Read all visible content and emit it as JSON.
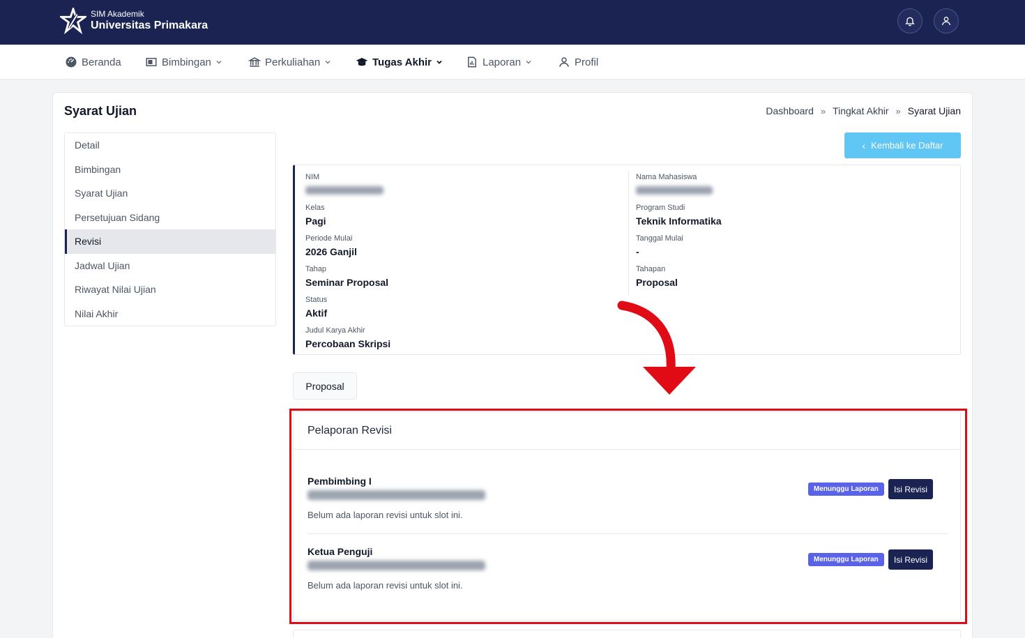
{
  "header": {
    "app_subtitle": "SIM Akademik",
    "app_name": "Universitas Primakara",
    "notification_icon": "bell-icon",
    "user_icon": "user-icon"
  },
  "nav": {
    "items": [
      {
        "label": "Beranda",
        "icon": "dashboard-icon"
      },
      {
        "label": "Bimbingan",
        "icon": "presentation-icon"
      },
      {
        "label": "Perkuliahan",
        "icon": "institution-icon"
      },
      {
        "label": "Tugas Akhir",
        "icon": "graduation-cap-icon",
        "active": true
      },
      {
        "label": "Laporan",
        "icon": "report-icon"
      },
      {
        "label": "Profil",
        "icon": "user-icon"
      }
    ]
  },
  "page": {
    "title": "Syarat Ujian",
    "breadcrumb": [
      "Dashboard",
      "Tingkat Akhir",
      "Syarat Ujian"
    ],
    "back_button": "Kembali ke Daftar"
  },
  "sidebar": {
    "items": [
      {
        "label": "Detail"
      },
      {
        "label": "Bimbingan"
      },
      {
        "label": "Syarat Ujian"
      },
      {
        "label": "Persetujuan Sidang"
      },
      {
        "label": "Revisi",
        "active": true
      },
      {
        "label": "Jadwal Ujian"
      },
      {
        "label": "Riwayat Nilai Ujian"
      },
      {
        "label": "Nilai Akhir"
      }
    ]
  },
  "student": {
    "nim_label": "NIM",
    "nama_label": "Nama Mahasiswa",
    "kelas_label": "Kelas",
    "kelas": "Pagi",
    "prodi_label": "Program Studi",
    "prodi": "Teknik Informatika",
    "periode_label": "Periode Mulai",
    "periode": "2026 Ganjil",
    "tanggal_label": "Tanggal Mulai",
    "tanggal": "-",
    "tahap_label": "Tahap",
    "tahap": "Seminar Proposal",
    "tahapan_label": "Tahapan",
    "tahapan": "Proposal",
    "status_label": "Status",
    "status": "Aktif",
    "judul_label": "Judul Karya Akhir",
    "judul": "Percobaan Skripsi"
  },
  "tabs": {
    "proposal": "Proposal"
  },
  "revision": {
    "title": "Pelaporan Revisi",
    "slots": [
      {
        "role": "Pembimbing I",
        "empty_text": "Belum ada laporan revisi untuk slot ini.",
        "badge": "Menunggu Laporan",
        "action": "Isi Revisi"
      },
      {
        "role": "Ketua Penguji",
        "empty_text": "Belum ada laporan revisi untuk slot ini.",
        "badge": "Menunggu Laporan",
        "action": "Isi Revisi"
      }
    ]
  },
  "colors": {
    "header_bg": "#1a2352",
    "accent_light_blue": "#60c7f4",
    "badge_purple": "#5a63e8",
    "highlight_red": "#e00b14"
  }
}
